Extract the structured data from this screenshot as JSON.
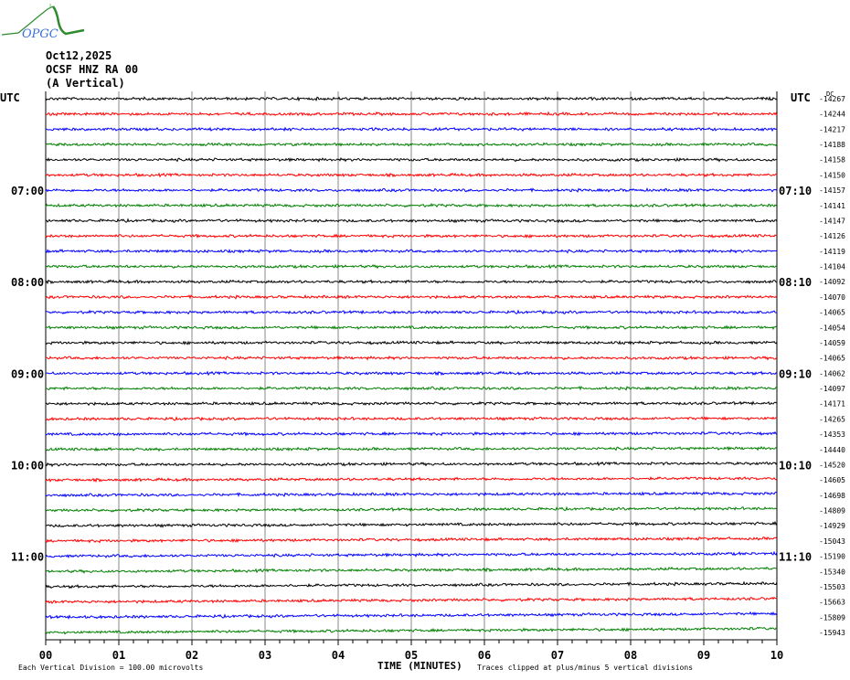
{
  "header": {
    "logo_text": "OPGC",
    "date": "Oct12,2025",
    "station": "OCSF HNZ RA 00",
    "component": "(A Vertical)"
  },
  "chart_data": {
    "type": "line",
    "title": "",
    "left_axis_label": "UTC",
    "right_axis_label": "UTC",
    "dc_label": "DC",
    "xlabel": "TIME (MINUTES)",
    "xlim": [
      0,
      10
    ],
    "x_ticks": [
      "00",
      "01",
      "02",
      "03",
      "04",
      "05",
      "06",
      "07",
      "08",
      "09",
      "10"
    ],
    "grid": true,
    "trace_colors": [
      "#000000",
      "#ff0000",
      "#0000ff",
      "#008000"
    ],
    "left_time_labels": [
      {
        "row": 6,
        "label": "07:00"
      },
      {
        "row": 12,
        "label": "08:00"
      },
      {
        "row": 18,
        "label": "09:00"
      },
      {
        "row": 24,
        "label": "10:00"
      },
      {
        "row": 30,
        "label": "11:00"
      }
    ],
    "right_time_labels": [
      {
        "row": 6,
        "label": "07:10"
      },
      {
        "row": 12,
        "label": "08:10"
      },
      {
        "row": 18,
        "label": "09:10"
      },
      {
        "row": 24,
        "label": "10:10"
      },
      {
        "row": 30,
        "label": "11:10"
      }
    ],
    "dc_offsets": [
      "-14267",
      "-14244",
      "-14217",
      "-14188",
      "-14158",
      "-14150",
      "-14157",
      "-14141",
      "-14147",
      "-14126",
      "-14119",
      "-14104",
      "-14092",
      "-14070",
      "-14065",
      "-14054",
      "-14059",
      "-14065",
      "-14062",
      "-14097",
      "-14171",
      "-14265",
      "-14353",
      "-14440",
      "-14520",
      "-14605",
      "-14698",
      "-14809",
      "-14929",
      "-15043",
      "-15190",
      "-15340",
      "-15503",
      "-15663",
      "-15809",
      "-15943"
    ],
    "footer_left": "Each Vertical Division =  100.00 microvolts",
    "footer_right": "Traces clipped at plus/minus 5 vertical divisions"
  }
}
